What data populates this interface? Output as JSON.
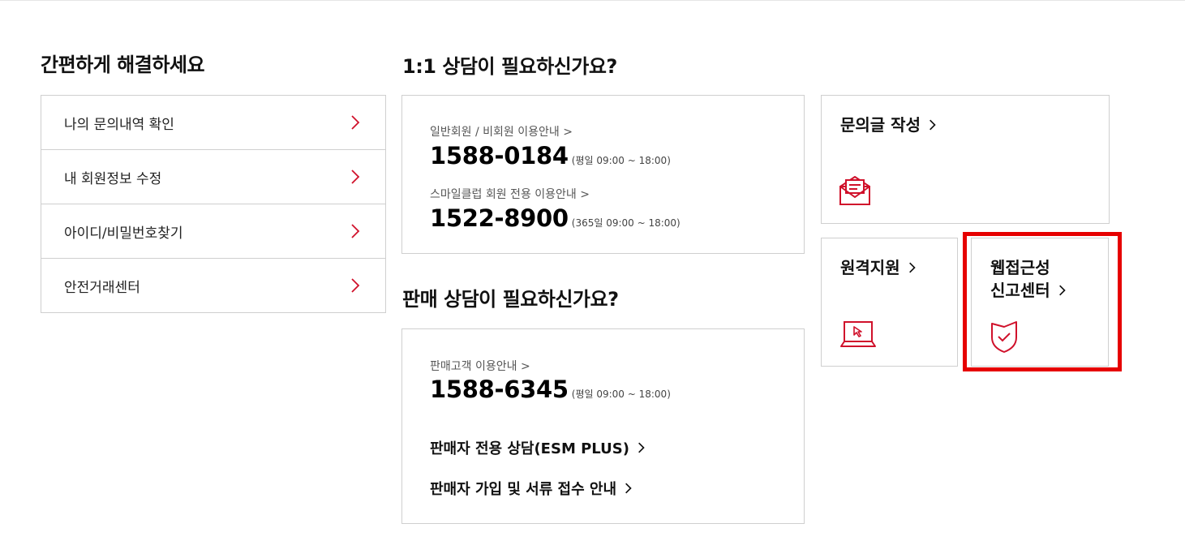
{
  "quick": {
    "title": "간편하게 해결하세요",
    "items": [
      {
        "label": "나의 문의내역 확인"
      },
      {
        "label": "내 회원정보 수정"
      },
      {
        "label": "아이디/비밀번호찾기"
      },
      {
        "label": "안전거래센터"
      }
    ]
  },
  "consult": {
    "title": "1:1 상담이 필요하신가요?",
    "general_label": "일반회원 / 비회원 이용안내 >",
    "general_phone": "1588-0184",
    "general_hours": "(평일 09:00 ~ 18:00)",
    "smile_label": "스마일클럽 회원 전용 이용안내 >",
    "smile_phone": "1522-8900",
    "smile_hours": "(365일 09:00 ~ 18:00)"
  },
  "sales": {
    "title": "판매 상담이 필요하신가요?",
    "customer_label": "판매고객 이용안내 >",
    "customer_phone": "1588-6345",
    "customer_hours": "(평일 09:00 ~ 18:00)",
    "seller_link": "판매자 전용 상담(ESM PLUS)",
    "join_link": "판매자 가입 및 서류 접수 안내"
  },
  "cards": {
    "inquiry": {
      "title": "문의글 작성",
      "icon": "envelope-icon"
    },
    "remote": {
      "title": "원격지원",
      "icon": "laptop-icon"
    },
    "accessibility": {
      "title_line1": "웹접근성",
      "title_line2": "신고센터",
      "icon": "shield-check-icon"
    }
  },
  "colors": {
    "accent": "#d0112b",
    "highlight": "#e60000",
    "border": "#cfcfcf"
  }
}
